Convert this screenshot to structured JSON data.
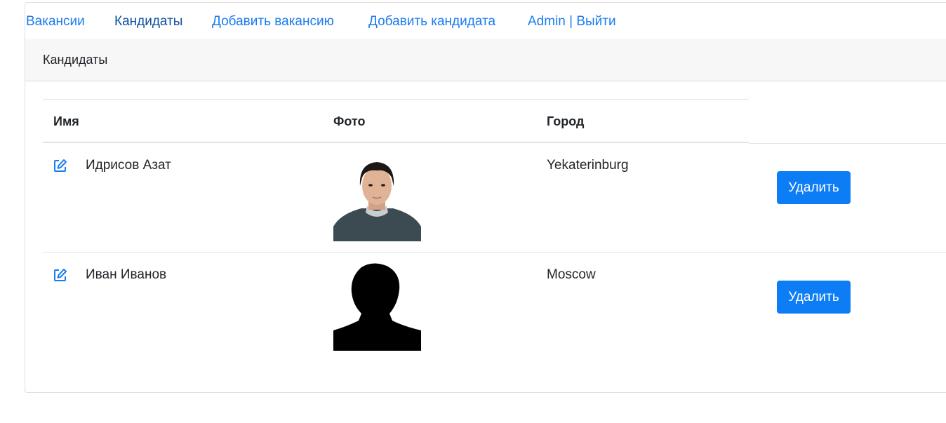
{
  "nav": {
    "items": [
      {
        "label": "Вакансии"
      },
      {
        "label": "Кандидаты"
      },
      {
        "label": "Добавить вакансию"
      },
      {
        "label": "Добавить кандидата"
      },
      {
        "label": "Admin | Выйти"
      }
    ]
  },
  "card": {
    "header": "Кандидаты"
  },
  "table": {
    "columns": [
      "Имя",
      "Фото",
      "Город"
    ],
    "rows": [
      {
        "name": "Идрисов Азат",
        "city": "Yekaterinburg",
        "photo_icon": "person-photo",
        "edit_icon": "edit-icon",
        "action": "Удалить"
      },
      {
        "name": "Иван Иванов",
        "city": "Moscow",
        "photo_icon": "person-silhouette",
        "edit_icon": "edit-icon",
        "action": "Удалить"
      }
    ]
  },
  "colors": {
    "link": "#1a7cf2",
    "button": "#0d7df5",
    "header_bg": "#f7f7f7"
  }
}
